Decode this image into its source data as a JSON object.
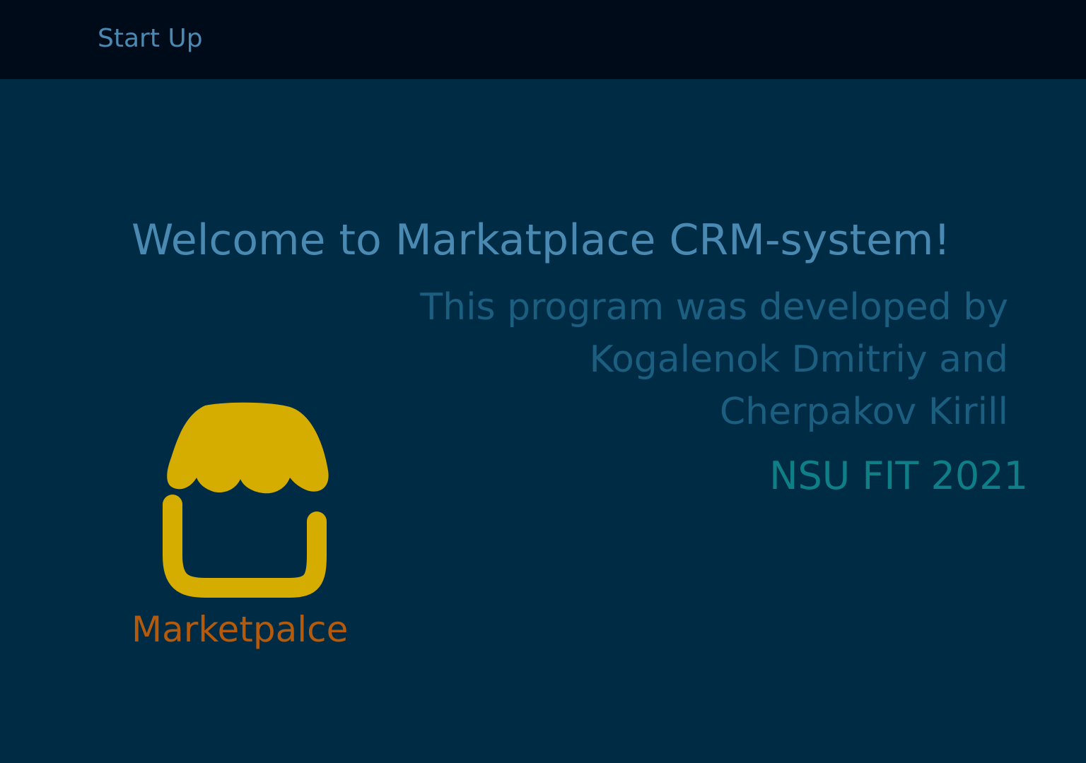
{
  "header": {
    "title": "Start Up"
  },
  "main": {
    "welcome": "Welcome to Markatplace CRM-system!",
    "credits": [
      "This program was developed by",
      "Kogalenok Dmitriy and",
      "Cherpakov Kirill"
    ],
    "organization": "NSU FIT 2021",
    "logo": {
      "icon": "shop-awning-icon",
      "label": "Marketpalce",
      "colors": {
        "awning": "#d4ad00",
        "label": "#b45a0c"
      }
    }
  },
  "colors": {
    "background": "#002b44",
    "header_background": "#000b1a",
    "title_text": "#4a8ab2",
    "credits_text": "#1c5e80",
    "organization_text": "#0f7e86"
  }
}
